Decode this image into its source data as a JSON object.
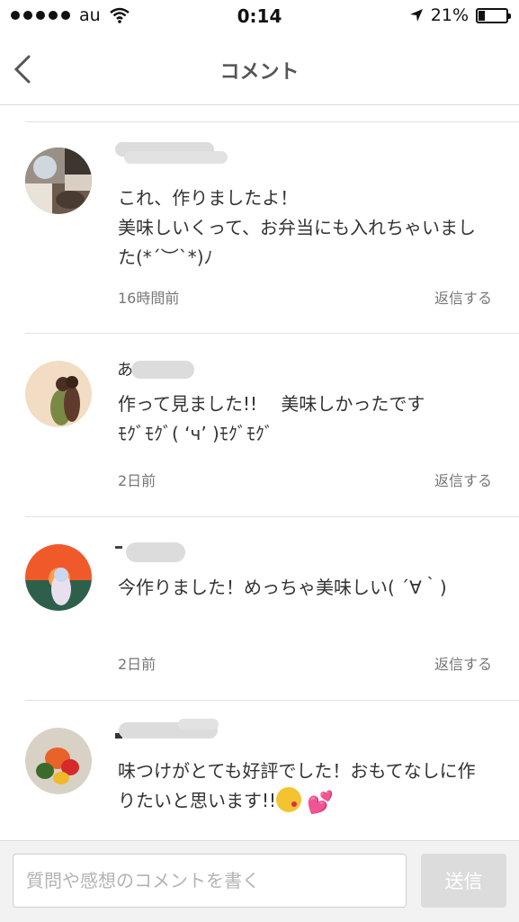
{
  "status_bar": {
    "carrier": "au",
    "time": "0:14",
    "battery_percent": "21%",
    "battery_level": 0.21
  },
  "nav": {
    "title": "コメント",
    "back_icon": "chevron-left-icon"
  },
  "comments": [
    {
      "text": "これ、作りましたよ！\n美味しいくって、お弁当にも入れちゃいました(*´︶`*)ﾉ",
      "time": "16時間前",
      "reply": "返信する"
    },
    {
      "text": "作って見ました!!　 美味しかったです\nﾓｸﾞﾓｸﾞ( ‘ч’ )ﾓｸﾞﾓｸﾞ",
      "time": "2日前",
      "reply": "返信する"
    },
    {
      "text": "今作りました！めっちゃ美味しい( ´∀｀)",
      "time": "2日前",
      "reply": "返信する"
    },
    {
      "text": "味つけがとても好評でした！おもてなしに作りたいと思います!!",
      "time": "",
      "reply": ""
    }
  ],
  "input": {
    "placeholder": "質問や感想のコメントを書く",
    "send_label": "送信"
  }
}
